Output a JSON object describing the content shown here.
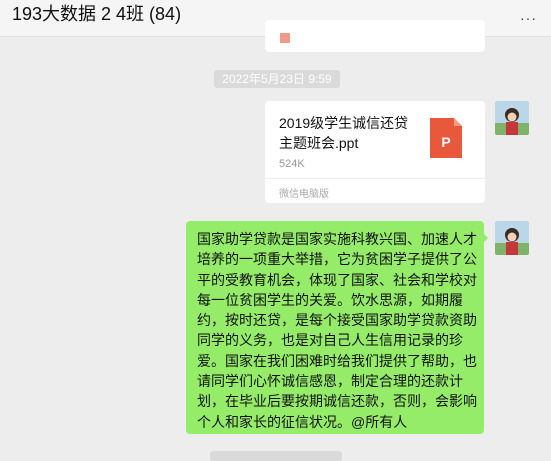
{
  "chat": {
    "title": "193大数据 2 4班 (84)",
    "more_label": "···"
  },
  "messages": {
    "timestamp": "2022年5月23日 9:59",
    "file": {
      "name": "2019级学生诚信还贷主题班会.ppt",
      "size": "524K",
      "source": "微信电脑版",
      "icon": "ppt-icon",
      "icon_color": "#e8593b"
    },
    "text": "国家助学贷款是国家实施科教兴国、加速人才培养的一项重大举措，它为贫困学子提供了公平的受教育机会，体现了国家、社会和学校对每一位贫困学生的关爱。饮水思源，如期履约，按时还贷，是每个接受国家助学贷款资助同学的义务，也是对自己人生信用记录的珍爱。国家在我们困难时给我们提供了帮助，也请同学们心怀诚信感恩，制定合理的还款计划，在毕业后要按期诚信还款，否则，会影响个人和家长的征信状况。@所有人"
  },
  "colors": {
    "bubble": "#95ec69",
    "background": "#ededed"
  }
}
